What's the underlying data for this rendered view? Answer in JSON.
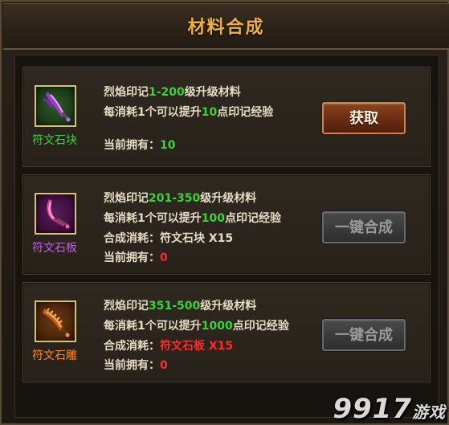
{
  "title": "材料合成",
  "items": [
    {
      "name": "符文石块",
      "name_color": "#3cd23c",
      "icon": "purple-blade-icon",
      "line1": {
        "pre": "烈焰印记",
        "range": "1-200",
        "post": "级升级材料"
      },
      "line2": {
        "pre": "每消耗1个可以提升",
        "amount": "10",
        "post": "点印记经验"
      },
      "owned_label": "当前拥有：",
      "owned_value": "10",
      "owned_color": "#3cd23c",
      "button_label": "获取"
    },
    {
      "name": "符文石板",
      "name_color": "#c060e8",
      "icon": "magenta-blade-icon",
      "line1": {
        "pre": "烈焰印记",
        "range": "201-350",
        "post": "级升级材料"
      },
      "line2": {
        "pre": "每消耗1个可以提升",
        "amount": "100",
        "post": "点印记经验"
      },
      "cost_label": "合成消耗：",
      "cost_value": "符文石块 X15",
      "owned_label": "当前拥有：",
      "owned_value": "0",
      "owned_color": "#ff2a2a",
      "button_label": "一键合成"
    },
    {
      "name": "符文石雕",
      "name_color": "#ff8a20",
      "icon": "orange-blade-icon",
      "line1": {
        "pre": "烈焰印记",
        "range": "351-500",
        "post": "级升级材料"
      },
      "line2": {
        "pre": "每消耗1个可以提升",
        "amount": "1000",
        "post": "点印记经验"
      },
      "cost_label": "合成消耗：",
      "cost_value": "符文石板 X15",
      "owned_label": "当前拥有：",
      "owned_value": "0",
      "owned_color": "#ff2a2a",
      "button_label": "一键合成"
    }
  ],
  "watermark": "9917",
  "watermark_suffix": "游戏"
}
